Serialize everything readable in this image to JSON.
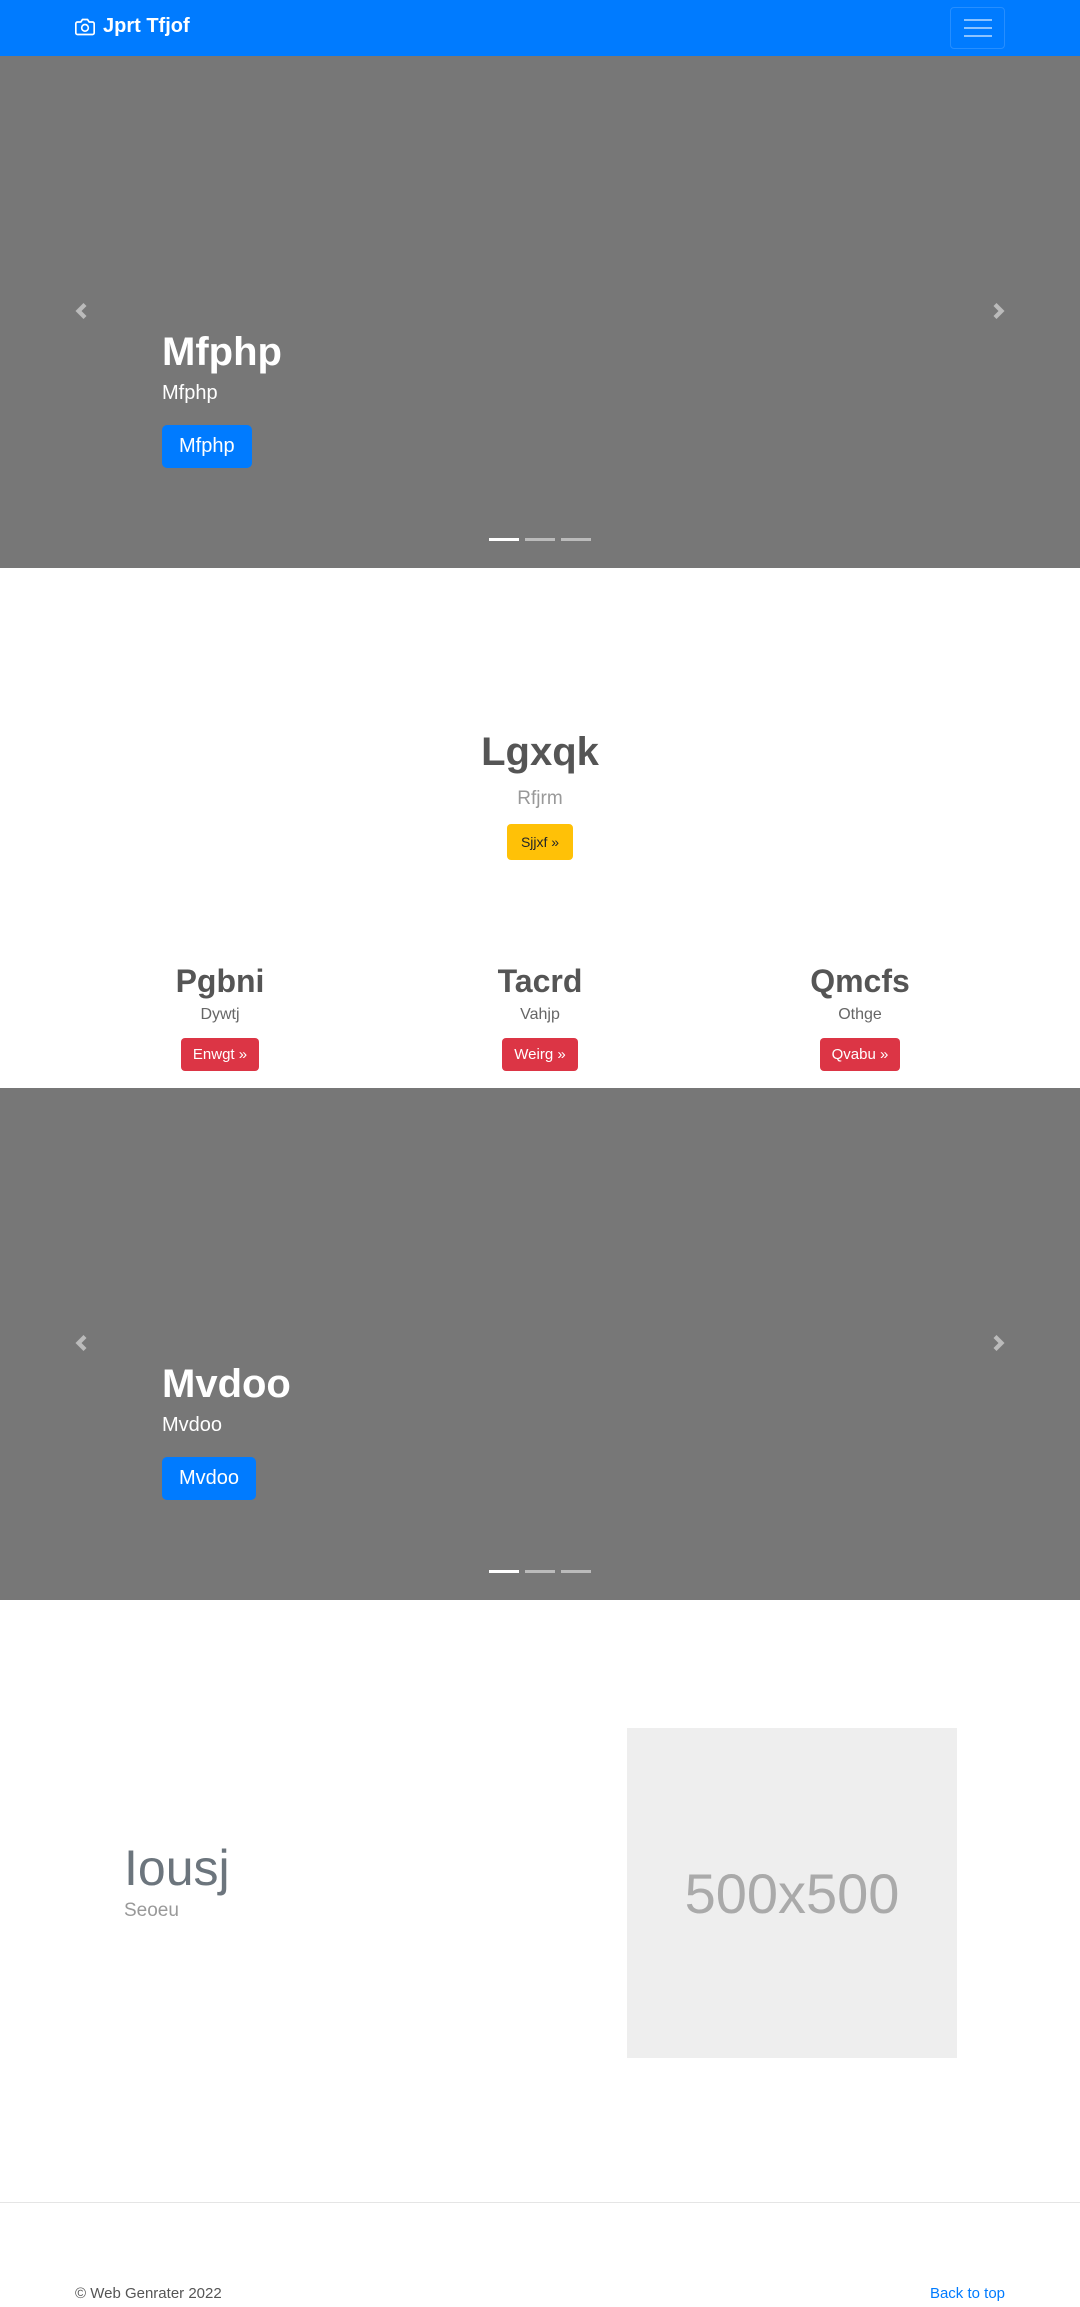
{
  "navbar": {
    "brand": "Jprt Tfjof",
    "brand_icon": "camera-icon",
    "toggler_icon": "hamburger-icon",
    "color": "#007bff"
  },
  "carousel1": {
    "title": "Mfphp",
    "subtitle": "Mfphp",
    "button": "Mfphp",
    "slides": 3,
    "active": 0
  },
  "hero": {
    "title": "Lgxqk",
    "subtitle": "Rfjrm",
    "button": "Sjjxf »"
  },
  "features": [
    {
      "title": "Pgbni",
      "text": "Dywtj",
      "button": "Enwgt »"
    },
    {
      "title": "Tacrd",
      "text": "Vahjp",
      "button": "Weirg »"
    },
    {
      "title": "Qmcfs",
      "text": "Othge",
      "button": "Qvabu »"
    }
  ],
  "carousel2": {
    "title": "Mvdoo",
    "subtitle": "Mvdoo",
    "button": "Mvdoo",
    "slides": 3,
    "active": 0
  },
  "featurette": {
    "title": "Iousj",
    "subtitle": "Seoeu",
    "image_label": "500x500"
  },
  "footer": {
    "copyright": "© Web Genrater 2022",
    "back_to_top": "Back to top"
  }
}
